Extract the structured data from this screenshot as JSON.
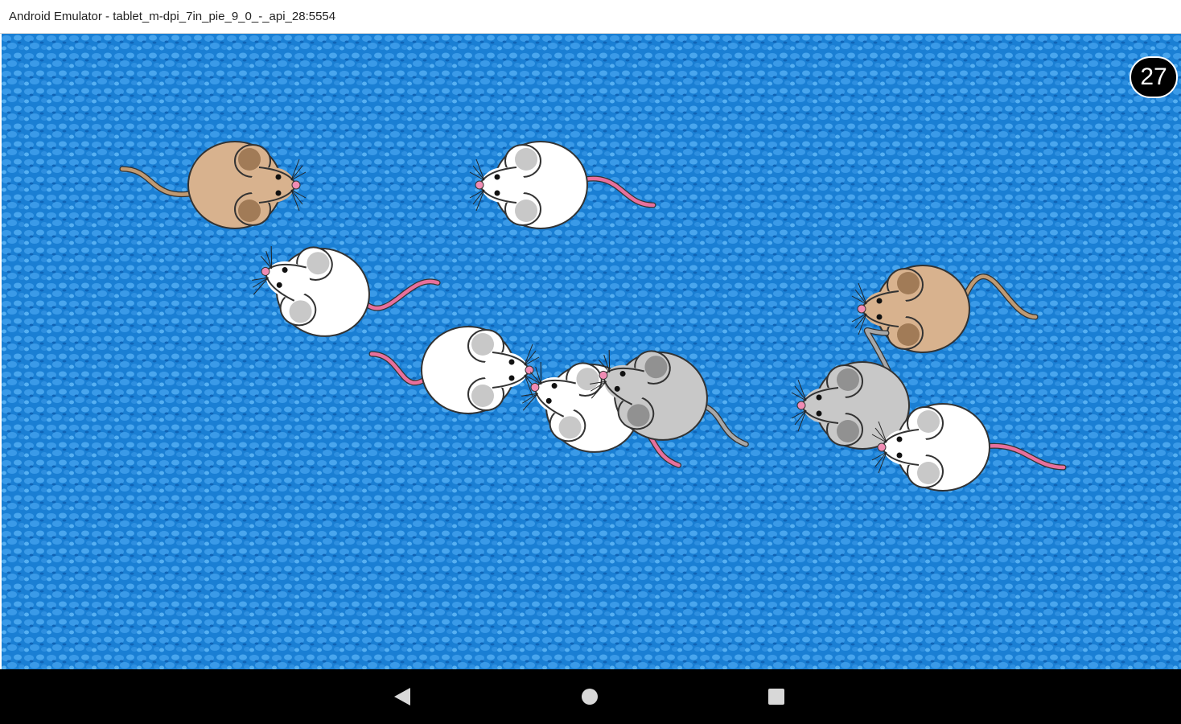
{
  "window": {
    "title": "Android Emulator - tablet_m-dpi_7in_pie_9_0_-_api_28:5554"
  },
  "game": {
    "score": "27",
    "background_color": "#1d86d9",
    "mice": [
      {
        "id": "tan-1",
        "fur": "#d8b28e",
        "tail": "#c09a72"
      },
      {
        "id": "white-1",
        "fur": "#ffffff",
        "tail": "#e8709c"
      },
      {
        "id": "white-2",
        "fur": "#ffffff",
        "tail": "#e8709c"
      },
      {
        "id": "white-3",
        "fur": "#ffffff",
        "tail": "#e8709c"
      },
      {
        "id": "white-4",
        "fur": "#ffffff",
        "tail": "#e8709c"
      },
      {
        "id": "gray-1",
        "fur": "#c8c8c8",
        "tail": "#a8a8a8"
      },
      {
        "id": "tan-2",
        "fur": "#d8b28e",
        "tail": "#c09a72"
      },
      {
        "id": "gray-2",
        "fur": "#c8c8c8",
        "tail": "#a8a8a8"
      },
      {
        "id": "white-5",
        "fur": "#ffffff",
        "tail": "#e8709c"
      }
    ]
  },
  "navigation": {
    "back_icon": "back-triangle-icon",
    "home_icon": "home-circle-icon",
    "recents_icon": "recents-square-icon"
  }
}
